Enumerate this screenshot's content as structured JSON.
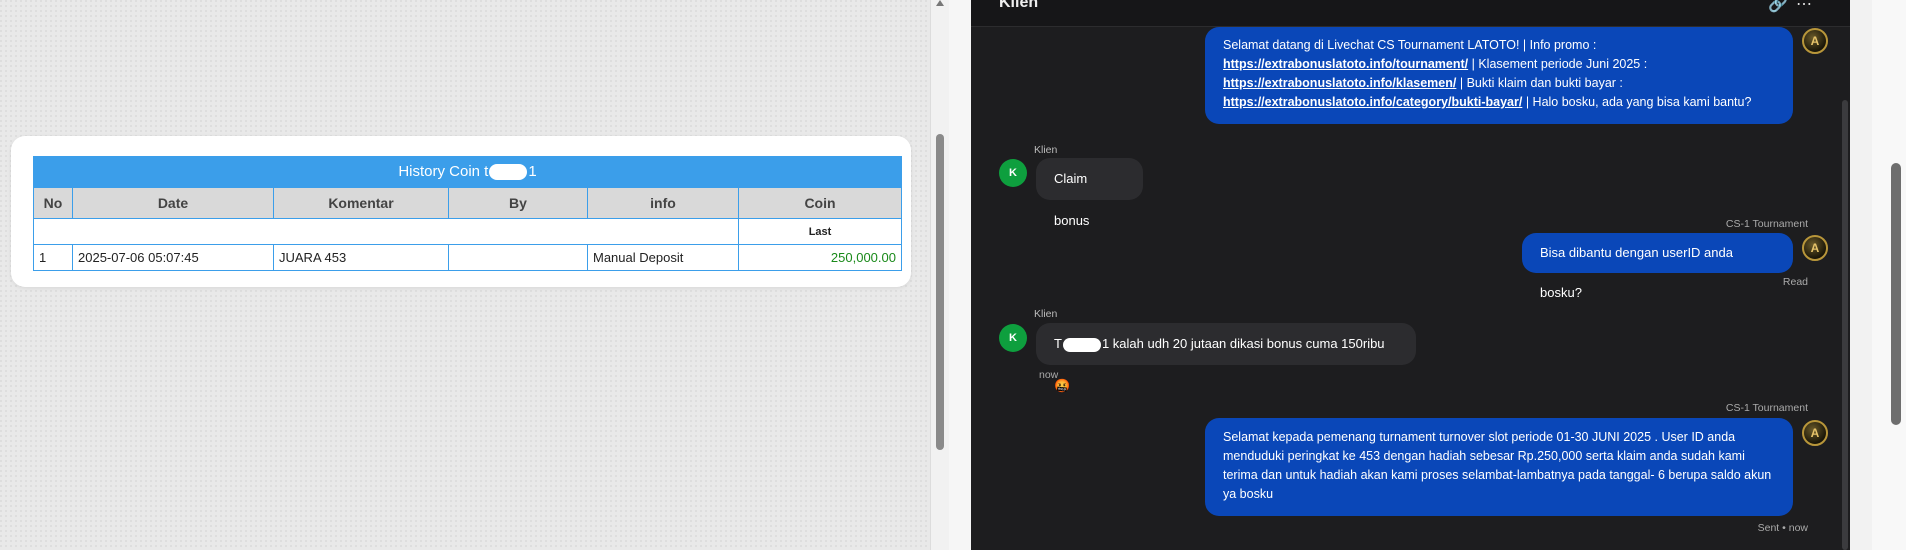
{
  "history": {
    "title_prefix": "History Coin t",
    "title_suffix": "1",
    "columns": [
      "No",
      "Date",
      "Komentar",
      "By",
      "info",
      "Coin"
    ],
    "last_label": "Last",
    "rows": [
      {
        "no": "1",
        "date": "2025-07-06 05:07:45",
        "komentar": "JUARA 453",
        "by": "",
        "info": "Manual Deposit",
        "coin": "250,000.00"
      }
    ]
  },
  "chat": {
    "header_title": "Klien",
    "header_icons": [
      "link-icon",
      "more-icon"
    ],
    "messages": [
      {
        "sender": "agent",
        "parts": [
          {
            "t": "text",
            "v": "Selamat datang di Livechat CS Tournament LATOTO! | Info promo : "
          },
          {
            "t": "link",
            "v": "https://extrabonuslatoto.info/tournament/"
          },
          {
            "t": "text",
            "v": " | Klasement periode Juni 2025 : "
          },
          {
            "t": "link",
            "v": "https://extrabonuslatoto.info/klasemen/"
          },
          {
            "t": "text",
            "v": " | Bukti klaim dan bukti bayar : "
          },
          {
            "t": "link",
            "v": "https://extrabonuslatoto.info/category/bukti-bayar/"
          },
          {
            "t": "text",
            "v": " | Halo bosku, ada yang bisa kami bantu?"
          }
        ]
      },
      {
        "sender": "client",
        "name": "Klien",
        "avatar": "K",
        "text": "Claim bonus"
      },
      {
        "sender": "agent",
        "name": "CS-1 Tournament",
        "text": "Bisa dibantu dengan userID anda bosku?",
        "status": "Read"
      },
      {
        "sender": "client",
        "name": "Klien",
        "avatar": "K",
        "text_prefix": "T",
        "text_suffix": "1 kalah udh 20 jutaan dikasi bonus cuma 150ribu",
        "emoji": "🤬",
        "time": "now"
      },
      {
        "sender": "agent",
        "name": "CS-1 Tournament",
        "text": "Selamat kepada pemenang turnament turnover slot periode 01-30 JUNI 2025 . User ID anda menduduki peringkat ke 453 dengan hadiah sebesar Rp.250,000 serta klaim anda sudah kami terima dan untuk hadiah akan kami proses selambat-lambatnya pada tanggal- 6 berupa saldo akun ya bosku",
        "status": "Sent • now"
      }
    ],
    "agent_avatar_letter": "A"
  }
}
